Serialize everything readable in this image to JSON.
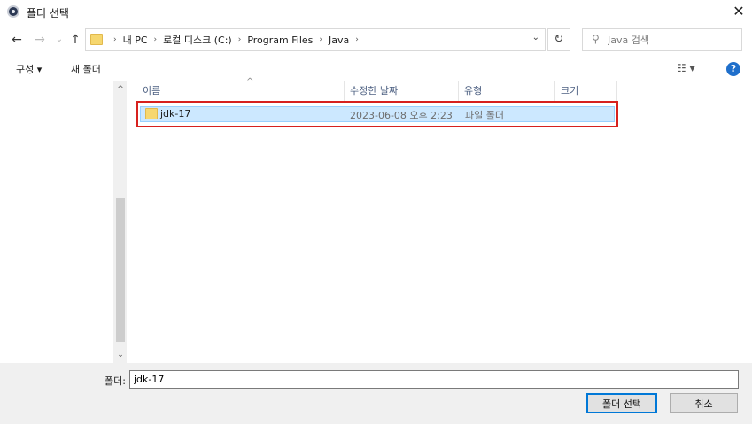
{
  "window": {
    "title": "폴더 선택",
    "close_glyph": "✕"
  },
  "nav": {
    "back_glyph": "←",
    "forward_glyph": "→",
    "recent_glyph": "⌄",
    "up_glyph": "↑",
    "breadcrumbs": [
      {
        "label": "내 PC"
      },
      {
        "label": "로컬 디스크 (C:)"
      },
      {
        "label": "Program Files"
      },
      {
        "label": "Java"
      }
    ],
    "breadcrumb_separator": "›",
    "address_dropdown_glyph": "⌄",
    "refresh_glyph": "↻",
    "search": {
      "placeholder": "Java 검색",
      "value": ""
    }
  },
  "toolbar": {
    "organize_label": "구성 ▾",
    "new_folder_label": "새 폴더",
    "view_label": "☷ ▾",
    "help_label": "?"
  },
  "file_list": {
    "sort_indicator": "^",
    "columns": [
      {
        "label": "이름"
      },
      {
        "label": "수정한 날짜"
      },
      {
        "label": "유형"
      },
      {
        "label": "크기"
      }
    ],
    "rows": [
      {
        "name": "jdk-17",
        "modified": "2023-06-08 오후 2:23",
        "type": "파일 폴더",
        "size": "",
        "selected": true
      }
    ]
  },
  "footer": {
    "folder_label": "폴더:",
    "folder_value": "jdk-17",
    "select_button": "폴더 선택",
    "cancel_button": "취소"
  },
  "colors": {
    "selection_bg": "#cce8ff",
    "highlight_box": "#d7211e",
    "primary_button_border": "#0078d7",
    "folder_icon": "#f6d76f",
    "help_icon": "#1f6fcb"
  },
  "icons": {
    "app": "app-icon",
    "folder": "folder-icon",
    "search": "search-icon",
    "refresh": "refresh-icon",
    "help": "help-icon",
    "view": "view-options-icon"
  },
  "scrollbar": {
    "up_glyph": "^",
    "down_glyph": "⌄"
  }
}
